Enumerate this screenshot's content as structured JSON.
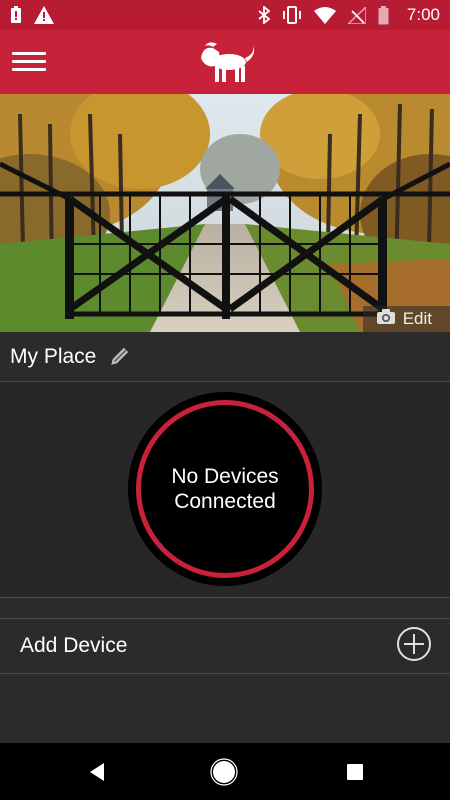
{
  "status_bar": {
    "time": "7:00",
    "left_icons": [
      "battery-alert-icon",
      "warning-icon"
    ],
    "right_icons": [
      "bluetooth-icon",
      "vibrate-icon",
      "wifi-icon",
      "no-signal-icon",
      "battery-icon"
    ]
  },
  "app_bar": {
    "menu_icon": "hamburger-menu-icon",
    "logo": "lion-logo"
  },
  "hero": {
    "edit_label": "Edit",
    "edit_icon": "camera-icon"
  },
  "place": {
    "title": "My Place",
    "edit_icon": "pencil-icon"
  },
  "devices": {
    "empty_line1": "No Devices",
    "empty_line2": "Connected"
  },
  "add_device": {
    "label": "Add Device",
    "icon": "add-circle-icon"
  },
  "colors": {
    "brand_red": "#c8223b",
    "status_red": "#b71c33",
    "background": "#2b2b2b"
  },
  "nav": {
    "back_icon": "back-triangle-icon",
    "home_icon": "home-circle-icon",
    "recents_icon": "recents-square-icon"
  }
}
